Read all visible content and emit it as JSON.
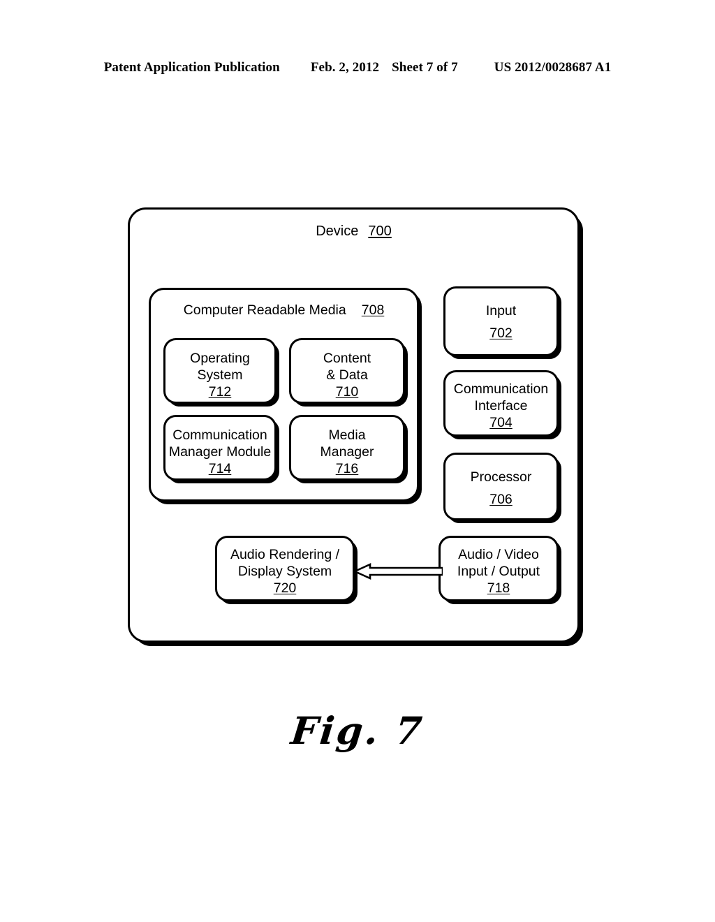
{
  "header": {
    "publication": "Patent Application Publication",
    "date": "Feb. 2, 2012",
    "sheet": "Sheet 7 of 7",
    "doc_number": "US 2012/0028687 A1"
  },
  "figure": {
    "caption": "Fig. 7",
    "device": {
      "label": "Device",
      "ref": "700"
    },
    "computer_readable_media": {
      "label": "Computer Readable Media",
      "ref": "708"
    },
    "modules": [
      {
        "name": "operating-system",
        "label": "Operating\nSystem",
        "ref": "712"
      },
      {
        "name": "content-and-data",
        "label": "Content\n& Data",
        "ref": "710"
      },
      {
        "name": "communication-manager-module",
        "label": "Communication\nManager Module",
        "ref": "714"
      },
      {
        "name": "media-manager",
        "label": "Media\nManager",
        "ref": "716"
      }
    ],
    "peripherals": [
      {
        "name": "input",
        "label": "Input",
        "ref": "702"
      },
      {
        "name": "communication-interface",
        "label": "Communication\nInterface",
        "ref": "704"
      },
      {
        "name": "processor",
        "label": "Processor",
        "ref": "706"
      }
    ],
    "io": [
      {
        "name": "audio-rendering-display-system",
        "label": "Audio Rendering /\nDisplay System",
        "ref": "720"
      },
      {
        "name": "audio-video-input-output",
        "label": "Audio / Video\nInput / Output",
        "ref": "718"
      }
    ],
    "connector": {
      "name": "av-io-to-rendering-arrow",
      "from": "718",
      "to": "720",
      "direction": "left"
    },
    "colors": {
      "ink": "#000000",
      "paper": "#ffffff"
    }
  }
}
